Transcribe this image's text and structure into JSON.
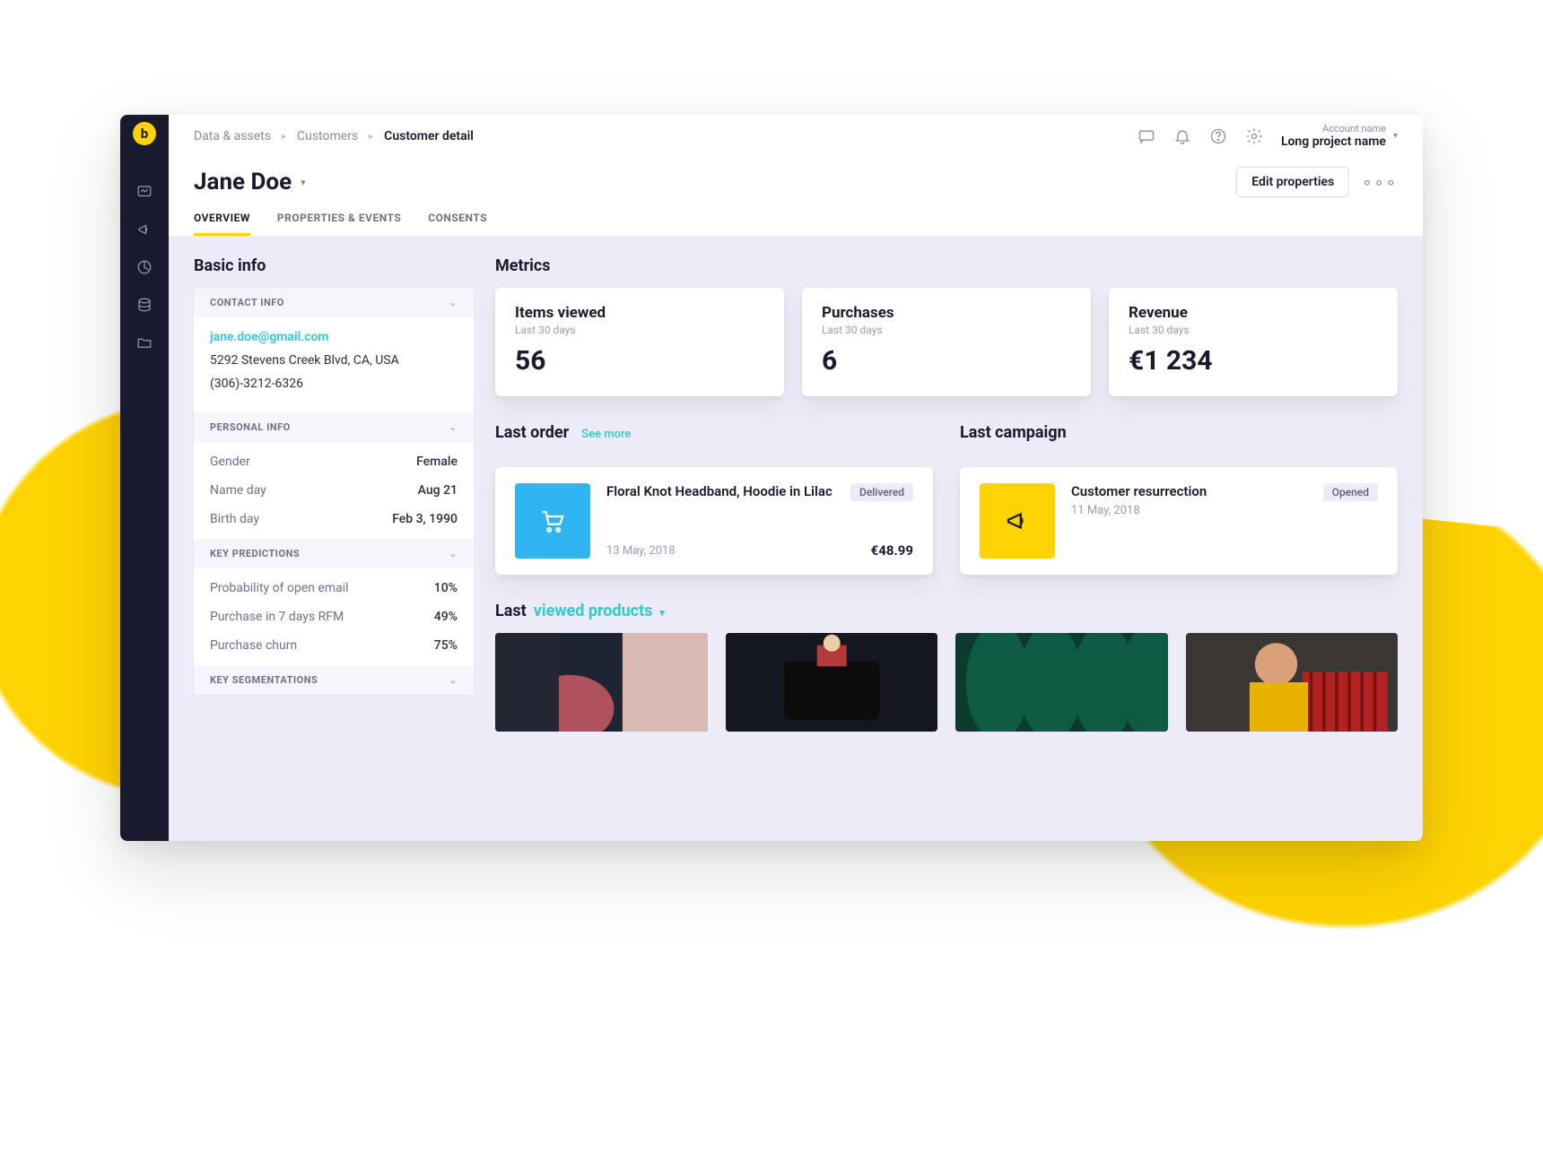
{
  "breadcrumb": {
    "a": "Data & assets",
    "b": "Customers",
    "c": "Customer detail"
  },
  "account": {
    "label": "Account name",
    "project": "Long project name"
  },
  "page": {
    "title": "Jane Doe",
    "edit_btn": "Edit properties"
  },
  "tabs": {
    "overview": "OVERVIEW",
    "props": "PROPERTIES & EVENTS",
    "consents": "CONSENTS"
  },
  "left": {
    "title": "Basic info",
    "contact_hdr": "CONTACT INFO",
    "email": "jane.doe@gmail.com",
    "address": "5292 Stevens Creek Blvd, CA, USA",
    "phone": "(306)-3212-6326",
    "personal_hdr": "PERSONAL INFO",
    "personal": [
      {
        "k": "Gender",
        "v": "Female"
      },
      {
        "k": "Name day",
        "v": "Aug 21"
      },
      {
        "k": "Birth day",
        "v": "Feb 3, 1990"
      }
    ],
    "pred_hdr": "KEY PREDICTIONS",
    "predictions": [
      {
        "k": "Probability of open email",
        "v": "10%"
      },
      {
        "k": "Purchase in 7 days RFM",
        "v": "49%"
      },
      {
        "k": "Purchase churn",
        "v": "75%"
      }
    ],
    "seg_hdr": "KEY SEGMENTATIONS"
  },
  "metrics": {
    "title": "Metrics",
    "sub": "Last 30 days",
    "items_viewed": {
      "title": "Items viewed",
      "value": "56"
    },
    "purchases": {
      "title": "Purchases",
      "value": "6"
    },
    "revenue": {
      "title": "Revenue",
      "value": "€1 234"
    }
  },
  "last_order": {
    "title": "Last order",
    "see_more": "See more",
    "name": "Floral Knot Headband, Hoodie in Lilac",
    "badge": "Delivered",
    "date": "13 May, 2018",
    "price": "€48.99"
  },
  "last_campaign": {
    "title": "Last campaign",
    "name": "Customer resurrection",
    "badge": "Opened",
    "date": "11 May, 2018"
  },
  "lvp": {
    "prefix": "Last",
    "link": "viewed products"
  }
}
